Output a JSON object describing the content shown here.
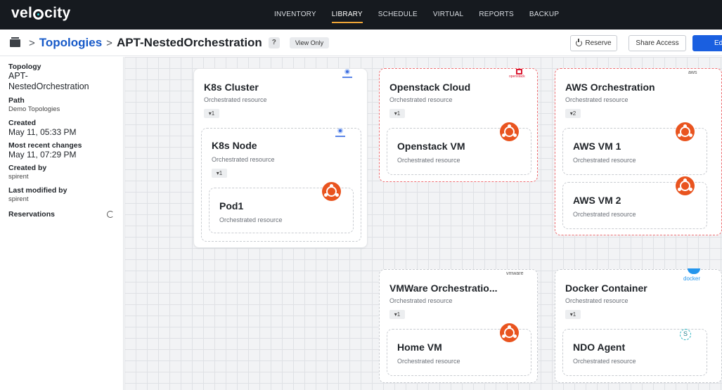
{
  "brand": {
    "name_prefix": "vel",
    "name_suffix": "city"
  },
  "nav": {
    "items": [
      "INVENTORY",
      "LIBRARY",
      "SCHEDULE",
      "VIRTUAL",
      "REPORTS",
      "BACKUP"
    ],
    "active": "LIBRARY"
  },
  "header": {
    "crumb_root": "Topologies",
    "crumb_current": "APT-NestedOrchestration",
    "help": "?",
    "view_only": "View Only",
    "reserve": "Reserve",
    "share_access": "Share Access",
    "edit": "Edi"
  },
  "sidebar": {
    "topology_label": "Topology",
    "topology_value": "APT-NestedOrchestration",
    "path_label": "Path",
    "path_value": "Demo Topologies",
    "created_label": "Created",
    "created_value": "May 11, 05:33 PM",
    "recent_label": "Most recent changes",
    "recent_value": "May 11, 07:29 PM",
    "created_by_label": "Created by",
    "created_by_value": "spirent",
    "modified_by_label": "Last modified by",
    "modified_by_value": "spirent",
    "reservations_label": "Reservations"
  },
  "canvas": {
    "k8s_cluster": {
      "title": "K8s Cluster",
      "sub": "Orchestrated resource",
      "count": "▾1"
    },
    "k8s_node": {
      "title": "K8s Node",
      "sub": "Orchestrated resource",
      "count": "▾1"
    },
    "pod1": {
      "title": "Pod1",
      "sub": "Orchestrated resource"
    },
    "openstack_cloud": {
      "title": "Openstack Cloud",
      "sub": "Orchestrated resource",
      "count": "▾1",
      "logo": "openstack"
    },
    "openstack_vm": {
      "title": "Openstack VM",
      "sub": "Orchestrated resource"
    },
    "aws_orch": {
      "title": "AWS Orchestration",
      "sub": "Orchestrated resource",
      "count": "▾2",
      "logo": "aws"
    },
    "aws_vm1": {
      "title": "AWS VM 1",
      "sub": "Orchestrated resource"
    },
    "aws_vm2": {
      "title": "AWS VM 2",
      "sub": "Orchestrated resource"
    },
    "vmware_orch": {
      "title": "VMWare Orchestratio...",
      "sub": "Orchestrated resource",
      "count": "▾1",
      "logo": "vmware"
    },
    "home_vm": {
      "title": "Home VM",
      "sub": "Orchestrated resource"
    },
    "docker": {
      "title": "Docker Container",
      "sub": "Orchestrated resource",
      "count": "▾1",
      "logo": "docker"
    },
    "ndo_agent": {
      "title": "NDO Agent",
      "sub": "Orchestrated resource",
      "icon_letter": "S"
    }
  },
  "colors": {
    "accent": "#f0a637",
    "brand_blue": "#1659c8",
    "ubuntu": "#e9541f",
    "openstack_red": "#da1a32",
    "docker_blue": "#2496ed"
  }
}
